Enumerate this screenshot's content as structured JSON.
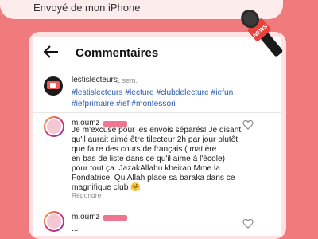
{
  "top_banner": {
    "text": "Envoyé de mon iPhone"
  },
  "decoration": {
    "mic_label": "NEWS"
  },
  "header": {
    "title": "Commentaires"
  },
  "post": {
    "username": "lestislecteurs",
    "time": "1 sem.",
    "hashtags": "#lestislecteurs #lecture #clubdelecture #iefun\n#iefprimaire #ief #montessori"
  },
  "comments": [
    {
      "username": "m.oumz",
      "text": "Je m'excuse pour les envois séparés! Je disant\nqu'il aurait aimé être tilecteur 2h par jour plutôt\nque faire des cours de français ( matière\nen bas de liste dans ce qu'il aime à l'école)\npour tout ça. JazakAllahu kheiran Mme la\nFondatrice. Qu Allah place sa baraka dans ce\nmagnifique club 🤗",
      "reply_label": "Répondre"
    },
    {
      "username": "m.oumz",
      "text": "..."
    }
  ],
  "colors": {
    "background": "#f07a7c",
    "hashtag": "#2b5bb0",
    "redaction": "#f0758f"
  }
}
